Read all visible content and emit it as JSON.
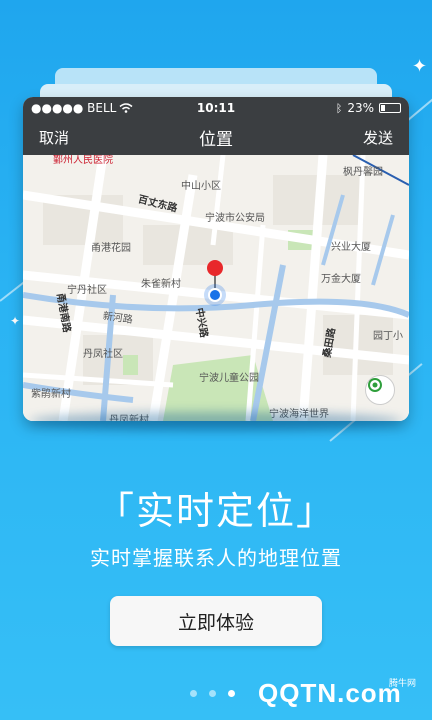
{
  "statusbar": {
    "carrier": "●●●●● BELL",
    "time": "10:11",
    "battery": "23%"
  },
  "navbar": {
    "cancel": "取消",
    "title": "位置",
    "send": "发送"
  },
  "map_labels": [
    "中山小区",
    "百丈东路",
    "宁波市公安局",
    "甬港花园",
    "兴业大厦",
    "宁丹社区",
    "朱雀新村",
    "万金大厦",
    "甬港南路",
    "新河路",
    "中兴路",
    "丹凤社区",
    "桑田路",
    "园丁小",
    "宁波儿童公园",
    "紫鹃新村",
    "宁波海洋世界",
    "枫丹馨园",
    "丹凤新村",
    "鄞州人民医院"
  ],
  "headline": "「实时定位」",
  "subline": "实时掌握联系人的地理位置",
  "cta": "立即体验",
  "watermark": {
    "logo": "QQTN.com",
    "small": "腾牛网"
  },
  "colors": {
    "background": "#29b0f2",
    "navbar": "#3b3e41",
    "pin": "#e8282b",
    "location_dot": "#1a73e8"
  }
}
